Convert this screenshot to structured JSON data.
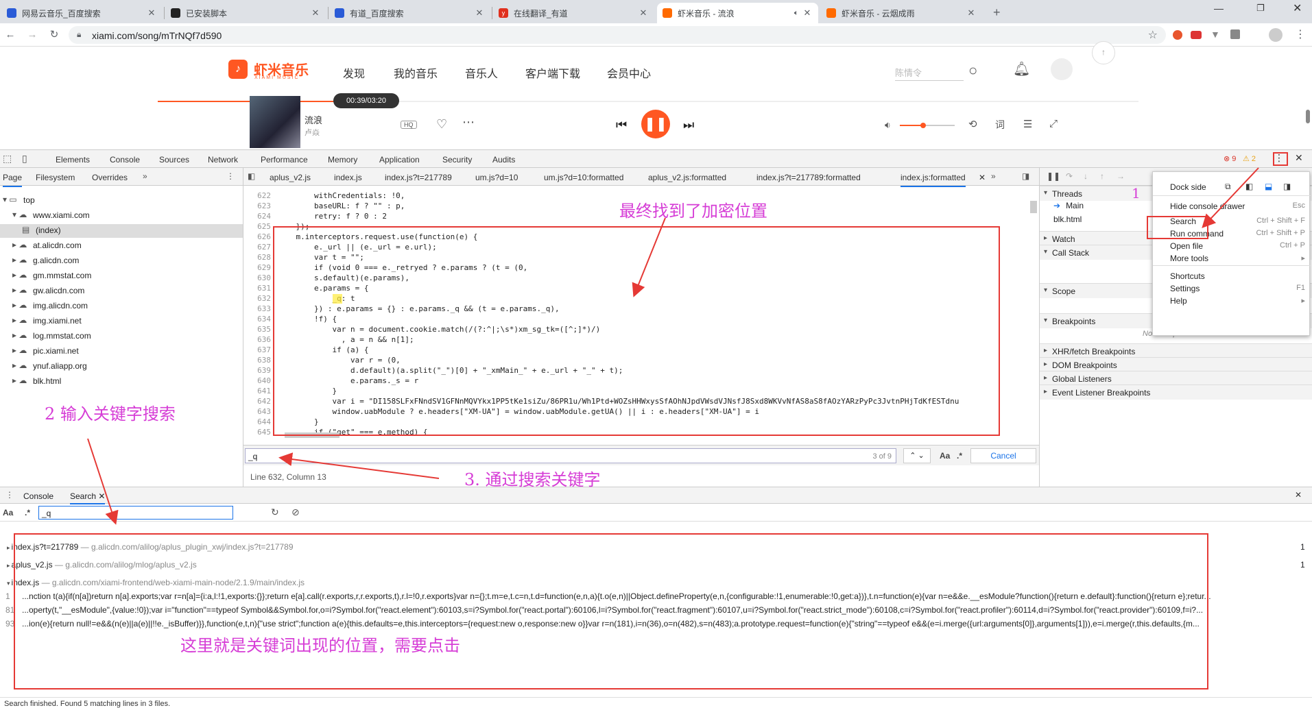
{
  "browser": {
    "tabs": [
      {
        "title": "网易云音乐_百度搜索",
        "fav_color": "#2a5bd7"
      },
      {
        "title": "已安装脚本",
        "fav_color": "#222222"
      },
      {
        "title": "有道_百度搜索",
        "fav_color": "#2a5bd7"
      },
      {
        "title": "在线翻译_有道",
        "fav_color": "#e0301e",
        "fav_text": "y"
      },
      {
        "title": "虾米音乐 - 流浪",
        "fav_color": "#ff6a00"
      },
      {
        "title": "虾米音乐 - 云烟成雨",
        "fav_color": "#ff6a00"
      }
    ],
    "url": "xiami.com/song/mTrNQf7d590"
  },
  "site": {
    "logo_text": "虾米音乐",
    "logo_sub": "XIAMI MUSIC",
    "nav": [
      "发现",
      "我的音乐",
      "音乐人",
      "客户端下载",
      "会员中心"
    ],
    "search_placeholder": "陈情令",
    "song_title": "流浪",
    "artist": "卢焱",
    "time": "00:39/03:20",
    "quality": "HQ",
    "progress": 0.2
  },
  "devtools": {
    "tabs": [
      "Elements",
      "Console",
      "Sources",
      "Network",
      "Performance",
      "Memory",
      "Application",
      "Security",
      "Audits"
    ],
    "error_count": "9",
    "warn_count": "2",
    "nav_tabs": [
      "Page",
      "Filesystem",
      "Overrides"
    ],
    "tree": [
      {
        "label": "top",
        "indent": 0
      },
      {
        "label": "www.xiami.com",
        "indent": 1
      },
      {
        "label": "(index)",
        "indent": 2
      },
      {
        "label": "at.alicdn.com",
        "indent": 1
      },
      {
        "label": "g.alicdn.com",
        "indent": 1
      },
      {
        "label": "gm.mmstat.com",
        "indent": 1
      },
      {
        "label": "gw.alicdn.com",
        "indent": 1
      },
      {
        "label": "img.alicdn.com",
        "indent": 1
      },
      {
        "label": "img.xiami.net",
        "indent": 1
      },
      {
        "label": "log.mmstat.com",
        "indent": 1
      },
      {
        "label": "pic.xiami.net",
        "indent": 1
      },
      {
        "label": "ynuf.aliapp.org",
        "indent": 1
      },
      {
        "label": "blk.html",
        "indent": 1
      }
    ],
    "file_tabs": [
      "aplus_v2.js",
      "index.js",
      "index.js?t=217789",
      "um.js?d=10",
      "um.js?d=10:formatted",
      "aplus_v2.js:formatted",
      "index.js?t=217789:formatted",
      "index.js:formatted"
    ],
    "code": [
      {
        "n": "622",
        "t": "        withCredentials: !0,"
      },
      {
        "n": "623",
        "t": "        baseURL: f ? \"\" : p,"
      },
      {
        "n": "624",
        "t": "        retry: f ? 0 : 2"
      },
      {
        "n": "625",
        "t": "    });"
      },
      {
        "n": "626",
        "t": "    m.interceptors.request.use(function(e) {"
      },
      {
        "n": "627",
        "t": "        e._url || (e._url = e.url);"
      },
      {
        "n": "628",
        "t": "        var t = \"\";"
      },
      {
        "n": "629",
        "t": "        if (void 0 === e._retryed ? e.params ? (t = (0,"
      },
      {
        "n": "630",
        "t": "        s.default)(e.params),"
      },
      {
        "n": "631",
        "t": "        e.params = {"
      },
      {
        "n": "632",
        "t": "            _q: t"
      },
      {
        "n": "633",
        "t": "        }) : e.params = {} : e.params._q && (t = e.params._q),"
      },
      {
        "n": "634",
        "t": "        !f) {"
      },
      {
        "n": "635",
        "t": "            var n = document.cookie.match(/(?:^|;\\s*)xm_sg_tk=([^;]*)/)"
      },
      {
        "n": "636",
        "t": "              , a = n && n[1];"
      },
      {
        "n": "637",
        "t": "            if (a) {"
      },
      {
        "n": "638",
        "t": "                var r = (0,"
      },
      {
        "n": "639",
        "t": "                d.default)(a.split(\"_\")[0] + \"_xmMain_\" + e._url + \"_\" + t);"
      },
      {
        "n": "640",
        "t": "                e.params._s = r"
      },
      {
        "n": "641",
        "t": "            }"
      },
      {
        "n": "642",
        "t": "            var i = \"DI158SLFxFNndSV1GFNnMQVYkx1PP5tKe1siZu/86PR1u/Wh1Ptd+WOZsHHWxysSfAOhNJpdVWsdVJNsfJ8Sxd8WKVvNfAS8aS8fAOzYARzPyPc3JvtnPHjTdKfESTdnu"
      },
      {
        "n": "643",
        "t": "            window.uabModule ? e.headers[\"XM-UA\"] = window.uabModule.getUA() || i : e.headers[\"XM-UA\"] = i"
      },
      {
        "n": "644",
        "t": "        }"
      },
      {
        "n": "645",
        "t": "        if (\"get\" === e.method) {"
      }
    ],
    "find_query": "_q",
    "find_count": "3 of 9",
    "find_cancel": "Cancel",
    "status": "Line 632, Column 13",
    "debug_sections": [
      "Threads",
      "Watch",
      "Call Stack",
      "Scope",
      "Breakpoints",
      "XHR/fetch Breakpoints",
      "DOM Breakpoints",
      "Global Listeners",
      "Event Listener Breakpoints"
    ],
    "threads": [
      "Main",
      "blk.html"
    ],
    "no_breakpoints": "No breakpoints",
    "menu": {
      "dock_side": "Dock side",
      "items": [
        {
          "label": "Hide console drawer",
          "shortcut": "Esc"
        },
        {
          "label": "Search",
          "shortcut": "Ctrl + Shift + F"
        },
        {
          "label": "Run command",
          "shortcut": "Ctrl + Shift + P"
        },
        {
          "label": "Open file",
          "shortcut": "Ctrl + P"
        },
        {
          "label": "More tools",
          "shortcut": "▸"
        },
        {
          "label": "Shortcuts",
          "shortcut": ""
        },
        {
          "label": "Settings",
          "shortcut": "F1"
        },
        {
          "label": "Help",
          "shortcut": "▸"
        }
      ]
    },
    "drawer": {
      "tabs": [
        "Console",
        "Search"
      ],
      "search_value": "_q",
      "results": [
        {
          "file": "index.js?t=217789",
          "path": "— g.alicdn.com/alilog/aplus_plugin_xwj/index.js?t=217789",
          "count": "1"
        },
        {
          "file": "aplus_v2.js",
          "path": "— g.alicdn.com/alilog/mlog/aplus_v2.js",
          "count": "1"
        },
        {
          "file": "index.js",
          "path": "— g.alicdn.com/xiami-frontend/web-xiami-main-node/2.1.9/main/index.js",
          "count": ""
        }
      ],
      "matches": [
        {
          "n": "1",
          "t": "...nction t(a){if(n[a])return n[a].exports;var r=n[a]={i:a,l:!1,exports:{}};return e[a].call(r.exports,r,r.exports,t),r.l=!0,r.exports}var n={};t.m=e,t.c=n,t.d=function(e,n,a){t.o(e,n)||Object.defineProperty(e,n,{configurable:!1,enumerable:!0,get:a})},t.n=function(e){var n=e&&e.__esModule?function(){return e.default}:function(){return e};retur..."
        },
        {
          "n": "81",
          "t": "...operty(t,\"__esModule\",{value:!0});var i=\"function\"==typeof Symbol&&Symbol.for,o=i?Symbol.for(\"react.element\"):60103,s=i?Symbol.for(\"react.portal\"):60106,l=i?Symbol.for(\"react.fragment\"):60107,u=i?Symbol.for(\"react.strict_mode\"):60108,c=i?Symbol.for(\"react.profiler\"):60114,d=i?Symbol.for(\"react.provider\"):60109,f=i?..."
        },
        {
          "n": "93",
          "t": "...ion(e){return null!=e&&(n(e)||a(e)||!!e._isBuffer)}},function(e,t,n){\"use strict\";function a(e){this.defaults=e,this.interceptors={request:new o,response:new o}}var r=n(181),i=n(36),o=n(482),s=n(483);a.prototype.request=function(e){\"string\"==typeof e&&(e=i.merge({url:arguments[0]},arguments[1])),e=i.merge(r,this.defaults,{m..."
        }
      ],
      "status": "Search finished.  Found 5 matching lines in 3 files."
    }
  },
  "annotations": {
    "a1": "最终找到了加密位置",
    "a2": "2  输入关键字搜索",
    "a3": "3. 通过搜索关键字",
    "a4": "这里就是关键词出现的位置，需要点击",
    "n1": "1"
  }
}
